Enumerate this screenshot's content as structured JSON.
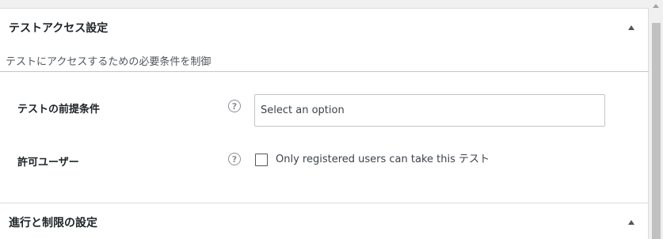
{
  "access_section": {
    "title": "テストアクセス設定",
    "description": "テストにアクセスするための必要条件を制御",
    "prerequisite": {
      "label": "テストの前提条件",
      "help": "?",
      "select_placeholder": "Select an option"
    },
    "allowed_users": {
      "label": "許可ユーザー",
      "help": "?",
      "checkbox_label": "Only registered users can take this テスト",
      "checked": false
    }
  },
  "progress_section": {
    "title": "進行と制限の設定"
  },
  "icons": {
    "collapse": "triangle-up-icon",
    "help": "question-circle-icon",
    "scroll_up": "scroll-up-arrow-icon"
  }
}
